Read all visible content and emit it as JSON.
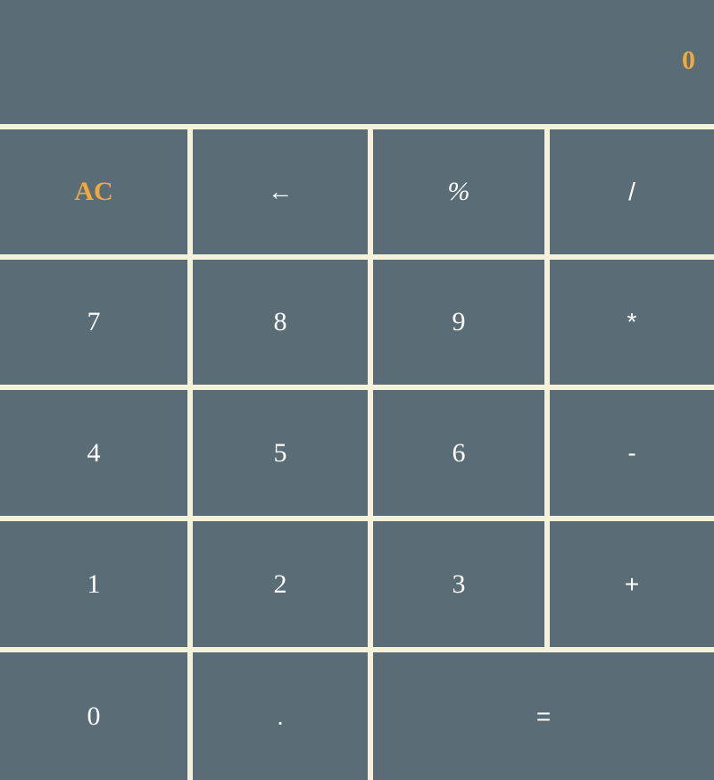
{
  "display": {
    "value": "0"
  },
  "keys": {
    "clear": "AC",
    "backspace": "←",
    "percent": "%",
    "divide": "/",
    "seven": "7",
    "eight": "8",
    "nine": "9",
    "multiply": "*",
    "four": "4",
    "five": "5",
    "six": "6",
    "subtract": "-",
    "one": "1",
    "two": "2",
    "three": "3",
    "add": "+",
    "zero": "0",
    "decimal": ".",
    "equals": "="
  },
  "colors": {
    "key_background": "#5a6d77",
    "gap_background": "#f5f2dc",
    "accent": "#f0a93c",
    "key_text": "#ffffff"
  }
}
